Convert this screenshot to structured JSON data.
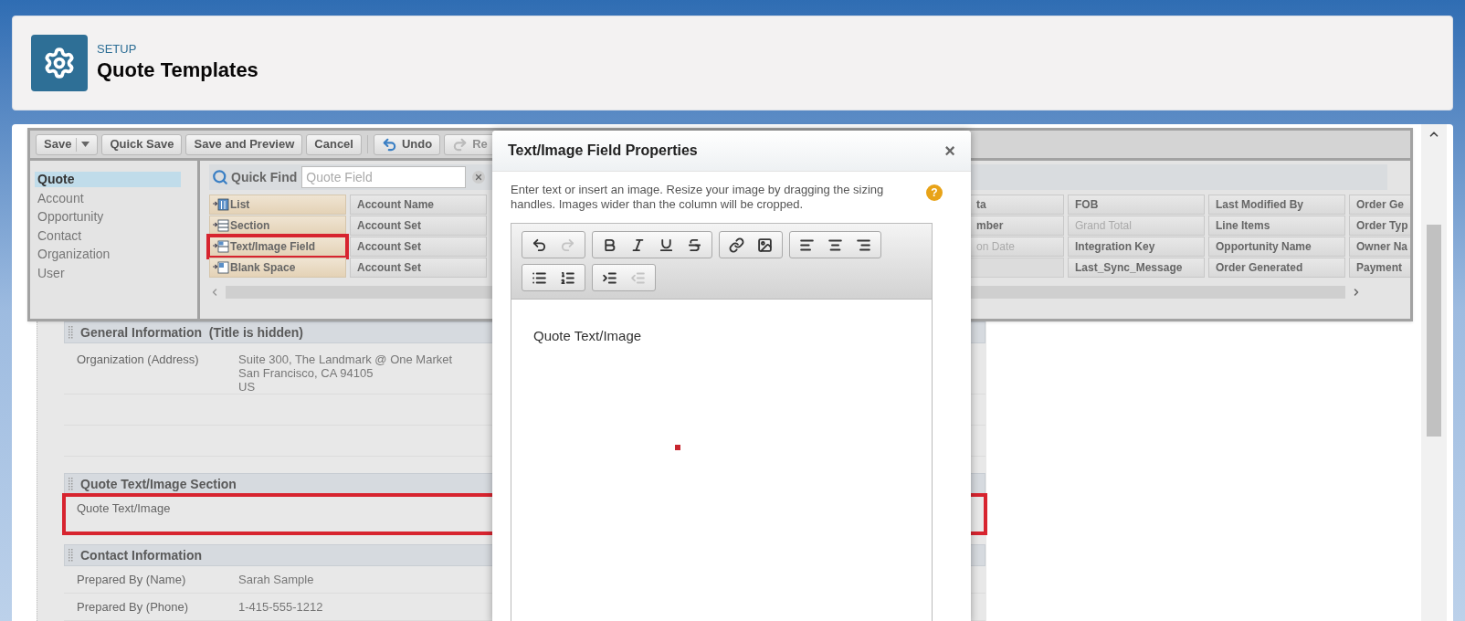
{
  "header": {
    "eyebrow": "SETUP",
    "title": "Quote Templates"
  },
  "toolbar": [
    {
      "label": "Save",
      "kind": "split",
      "disabled": false
    },
    {
      "label": "Quick Save",
      "kind": "plain",
      "disabled": false
    },
    {
      "label": "Save and Preview",
      "kind": "plain",
      "disabled": false
    },
    {
      "label": "Cancel",
      "kind": "plain",
      "disabled": false
    },
    {
      "label": "Undo",
      "kind": "undo",
      "disabled": false
    },
    {
      "label": "Re",
      "kind": "redo",
      "disabled": true
    }
  ],
  "objects": [
    {
      "label": "Quote",
      "selected": true
    },
    {
      "label": "Account",
      "selected": false
    },
    {
      "label": "Opportunity",
      "selected": false
    },
    {
      "label": "Contact",
      "selected": false
    },
    {
      "label": "Organization",
      "selected": false
    },
    {
      "label": "User",
      "selected": false
    }
  ],
  "quick_find": {
    "label": "Quick Find",
    "placeholder": "Quote Field"
  },
  "field_columns": [
    {
      "cells": [
        {
          "label": "List",
          "kind": "list",
          "dimmed": false,
          "highlighted": false
        },
        {
          "label": "Section",
          "kind": "section",
          "dimmed": false,
          "highlighted": false
        },
        {
          "label": "Text/Image Field",
          "kind": "text_image",
          "dimmed": false,
          "highlighted": true
        },
        {
          "label": "Blank Space",
          "kind": "blank",
          "dimmed": false,
          "highlighted": false
        }
      ]
    },
    {
      "cells": [
        {
          "label": "Account Name",
          "kind": "field",
          "dimmed": false,
          "highlighted": false
        },
        {
          "label": "Account Set",
          "kind": "field",
          "dimmed": false,
          "highlighted": false
        },
        {
          "label": "Account Set",
          "kind": "field",
          "dimmed": false,
          "highlighted": false
        },
        {
          "label": "Account Set",
          "kind": "field",
          "dimmed": false,
          "highlighted": false
        }
      ]
    },
    {
      "cells": [
        {
          "label": "ta",
          "kind": "cut_field",
          "dimmed": false,
          "highlighted": false
        },
        {
          "label": "mber",
          "kind": "cut_field",
          "dimmed": false,
          "highlighted": false
        },
        {
          "label": "on Date",
          "kind": "cut_field",
          "dimmed": true,
          "highlighted": false
        }
      ]
    },
    {
      "cells": [
        {
          "label": "FOB",
          "kind": "field",
          "dimmed": false,
          "highlighted": false
        },
        {
          "label": "Grand Total",
          "kind": "field",
          "dimmed": true,
          "highlighted": false
        },
        {
          "label": "Integration Key",
          "kind": "field",
          "dimmed": false,
          "highlighted": false
        },
        {
          "label": "Last_Sync_Message",
          "kind": "field",
          "dimmed": false,
          "highlighted": false
        }
      ]
    },
    {
      "cells": [
        {
          "label": "Last Modified By",
          "kind": "field",
          "dimmed": false,
          "highlighted": false
        },
        {
          "label": "Line Items",
          "kind": "field",
          "dimmed": false,
          "highlighted": false
        },
        {
          "label": "Opportunity Name",
          "kind": "field",
          "dimmed": false,
          "highlighted": false
        },
        {
          "label": "Order Generated",
          "kind": "field",
          "dimmed": false,
          "highlighted": false
        }
      ]
    },
    {
      "cells": [
        {
          "label": "Order Ge",
          "kind": "field",
          "dimmed": false,
          "highlighted": false
        },
        {
          "label": "Order Typ",
          "kind": "field",
          "dimmed": false,
          "highlighted": false
        },
        {
          "label": "Owner Na",
          "kind": "field",
          "dimmed": false,
          "highlighted": false
        },
        {
          "label": "Payment",
          "kind": "field",
          "dimmed": false,
          "highlighted": false
        }
      ]
    }
  ],
  "sections": [
    {
      "title": "General Information  (Title is hidden)",
      "rows": [
        {
          "label": "Organization (Address)",
          "value_lines": [
            "Suite 300, The Landmark @ One Market",
            "San Francisco, CA 94105",
            "US"
          ],
          "highlighted": false
        },
        {
          "highlighted": false
        },
        {
          "highlighted": false
        }
      ]
    },
    {
      "title": "Quote Text/Image Section",
      "rows": [
        {
          "label": "Quote Text/Image",
          "highlighted": true
        }
      ]
    },
    {
      "title": "Contact Information",
      "rows": [
        {
          "label": "Prepared By (Name)",
          "value_lines": [
            "Sarah Sample"
          ],
          "highlighted": false
        },
        {
          "label": "Prepared By (Phone)",
          "value_lines": [
            "1-415-555-1212"
          ],
          "highlighted": false
        }
      ]
    }
  ],
  "modal": {
    "title": "Text/Image Field Properties",
    "close": "×",
    "description": "Enter text or insert an image. Resize your image by dragging the sizing handles. Images wider than the column will be cropped.",
    "help": "?",
    "editor_toolbar": [
      [
        {
          "kind": "undo",
          "disabled": false
        },
        {
          "kind": "redo",
          "disabled": true
        }
      ],
      [
        {
          "kind": "bold",
          "disabled": false
        },
        {
          "kind": "italic",
          "disabled": false
        },
        {
          "kind": "underline",
          "disabled": false
        },
        {
          "kind": "strike",
          "disabled": false
        }
      ],
      [
        {
          "kind": "link",
          "disabled": false
        },
        {
          "kind": "image",
          "disabled": false
        }
      ],
      [
        {
          "kind": "align_left",
          "disabled": false
        },
        {
          "kind": "align_center",
          "disabled": false
        },
        {
          "kind": "align_right",
          "disabled": false
        }
      ],
      [
        {
          "kind": "bullets",
          "disabled": false
        },
        {
          "kind": "numbers",
          "disabled": false
        }
      ],
      [
        {
          "kind": "indent",
          "disabled": false
        },
        {
          "kind": "outdent",
          "disabled": true
        }
      ]
    ],
    "content": "Quote Text/Image"
  }
}
